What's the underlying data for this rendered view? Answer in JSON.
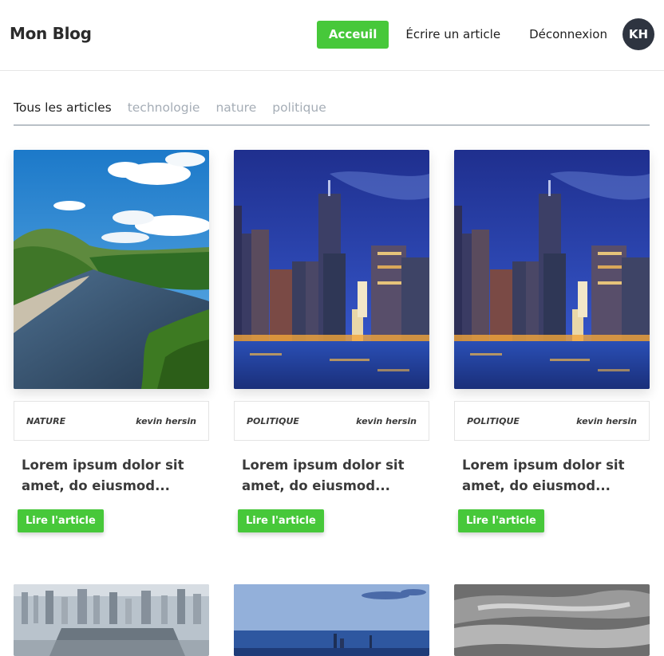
{
  "header": {
    "brand": "Mon Blog",
    "nav": {
      "home": "Acceuil",
      "write": "Écrire un article",
      "logout": "Déconnexion"
    },
    "avatar_initials": "KH"
  },
  "tabs": [
    {
      "label": "Tous les articles"
    },
    {
      "label": "technologie"
    },
    {
      "label": "nature"
    },
    {
      "label": "politique"
    }
  ],
  "articles": [
    {
      "category": "NATURE",
      "author": "kevin hersin",
      "title": "Lorem ipsum dolor sit amet, do eiusmod...",
      "button": "Lire l'article"
    },
    {
      "category": "POLITIQUE",
      "author": "kevin hersin",
      "title": "Lorem ipsum dolor sit amet, do eiusmod...",
      "button": "Lire l'article"
    },
    {
      "category": "POLITIQUE",
      "author": "kevin hersin",
      "title": "Lorem ipsum dolor sit amet, do eiusmod...",
      "button": "Lire l'article"
    }
  ],
  "colors": {
    "accent": "#47c83a",
    "avatar_bg": "#2e3440",
    "tab_inactive": "#a5adb6"
  }
}
